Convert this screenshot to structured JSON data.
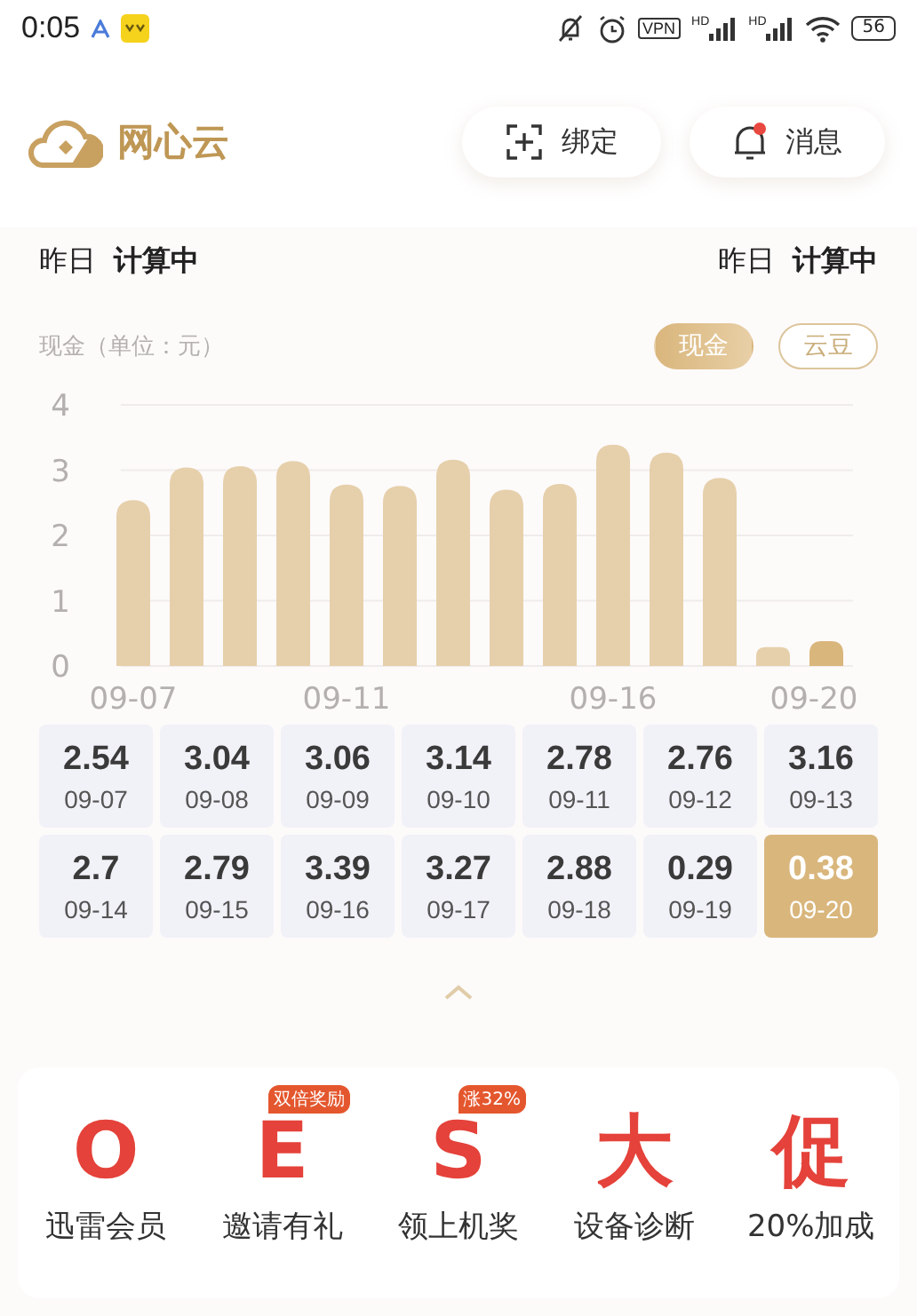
{
  "status_bar": {
    "time": "0:05",
    "vpn": "VPN",
    "signal_labels": [
      "HD",
      "HD"
    ],
    "battery": "56"
  },
  "header": {
    "brand": "网心云",
    "buttons": [
      {
        "kind": "bind",
        "label": "绑定",
        "dot": false
      },
      {
        "kind": "message",
        "label": "消息",
        "dot": true
      }
    ]
  },
  "summary": [
    {
      "label": "昨日",
      "value": "计算中"
    },
    {
      "label": "昨日",
      "value": "计算中"
    }
  ],
  "chart_section": {
    "title": "现金（单位：元）",
    "tabs": [
      {
        "label": "现金",
        "selected": true
      },
      {
        "label": "云豆",
        "selected": false
      }
    ],
    "chart_data": {
      "type": "bar",
      "categories": [
        "09-07",
        null,
        null,
        null,
        "09-11",
        null,
        null,
        null,
        null,
        "09-16",
        null,
        null,
        null,
        "09-20"
      ],
      "grid": true,
      "values": [
        2.54,
        3.04,
        3.06,
        3.14,
        2.78,
        2.76,
        3.16,
        2.7,
        2.79,
        3.39,
        3.27,
        2.88,
        0.29,
        0.38
      ],
      "ylim": [
        0,
        4
      ],
      "yticks": [
        0,
        1,
        2,
        3,
        4
      ]
    }
  },
  "daily": [
    {
      "amount": "2.54",
      "date": "09-07",
      "selected": false
    },
    {
      "amount": "3.04",
      "date": "09-08",
      "selected": false
    },
    {
      "amount": "3.06",
      "date": "09-09",
      "selected": false
    },
    {
      "amount": "3.14",
      "date": "09-10",
      "selected": false
    },
    {
      "amount": "2.78",
      "date": "09-11",
      "selected": false
    },
    {
      "amount": "2.76",
      "date": "09-12",
      "selected": false
    },
    {
      "amount": "3.16",
      "date": "09-13",
      "selected": false
    },
    {
      "amount": "2.7",
      "date": "09-14",
      "selected": false
    },
    {
      "amount": "2.79",
      "date": "09-15",
      "selected": false
    },
    {
      "amount": "3.39",
      "date": "09-16",
      "selected": false
    },
    {
      "amount": "3.27",
      "date": "09-17",
      "selected": false
    },
    {
      "amount": "2.88",
      "date": "09-18",
      "selected": false
    },
    {
      "amount": "0.29",
      "date": "09-19",
      "selected": false
    },
    {
      "amount": "0.38",
      "date": "09-20",
      "selected": true
    }
  ],
  "shortcuts": [
    {
      "glyph": "O",
      "label": "迅雷会员"
    },
    {
      "glyph": "E",
      "label": "邀请有礼",
      "badge": "双倍奖励"
    },
    {
      "glyph": "S",
      "label": "领上机奖",
      "badge": "涨32%"
    },
    {
      "glyph": "大",
      "label": "设备诊断"
    },
    {
      "glyph": "促",
      "label": "20%加成"
    }
  ]
}
